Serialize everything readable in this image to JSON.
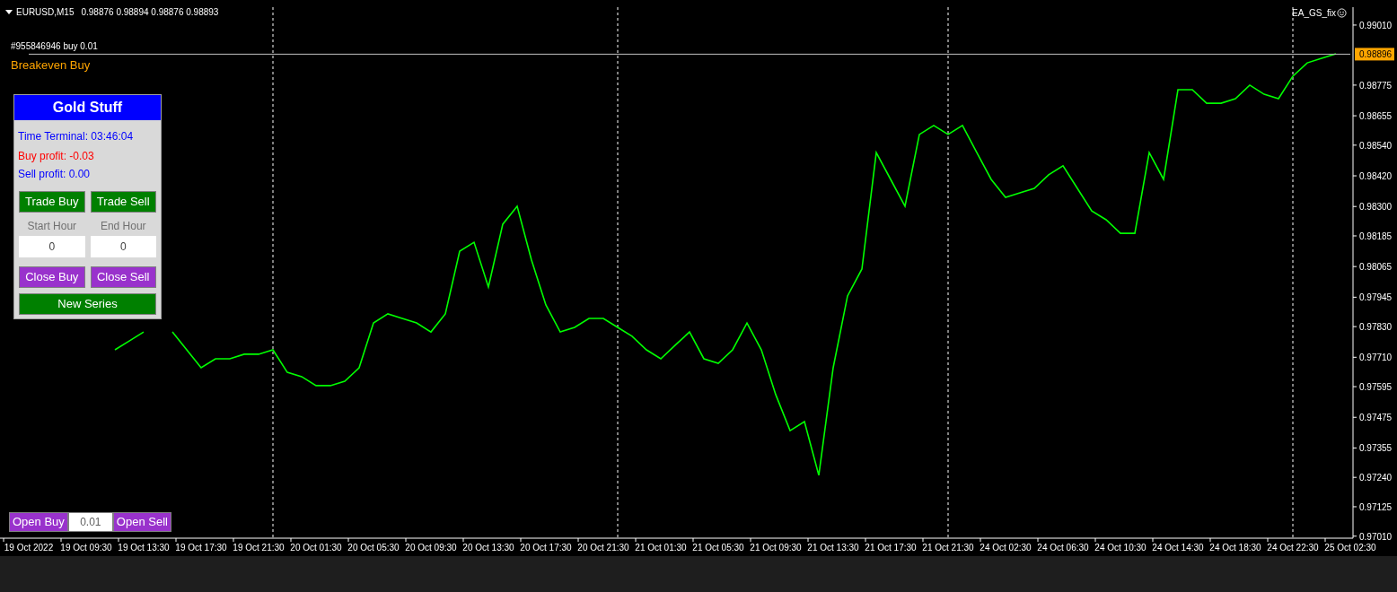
{
  "chart_header": {
    "symbol": "EURUSD,M15",
    "ohlc": "0.98876 0.98894 0.98876 0.98893"
  },
  "expert": {
    "name": "EA_GS_fix"
  },
  "order_line": {
    "label": "#955846946 buy 0.01",
    "breakeven_label": "Breakeven Buy"
  },
  "panel": {
    "title": "Gold Stuff",
    "time": "Time Terminal: 03:46:04",
    "buy_profit": "Buy profit: -0.03",
    "sell_profit": "Sell profit: 0.00",
    "trade_buttons": [
      "Trade Buy",
      "Trade Sell"
    ],
    "hour_fields": [
      {
        "label": "Start Hour",
        "value": "0"
      },
      {
        "label": "End Hour",
        "value": "0"
      }
    ],
    "close_buttons": [
      "Close Buy",
      "Close Sell"
    ],
    "series_button": "New Series"
  },
  "quick_trade": {
    "buy": "Open Buy",
    "lot": "0.01",
    "sell": "Open Sell"
  },
  "chart_data": {
    "type": "line",
    "ylim": [
      0.97002,
      0.9908
    ],
    "categories": [
      "19 Oct 2022",
      null,
      null,
      null,
      "19 Oct 09:30",
      null,
      null,
      null,
      "19 Oct 13:30",
      null,
      null,
      null,
      "19 Oct 17:30",
      null,
      null,
      null,
      "19 Oct 21:30",
      null,
      null,
      null,
      "20 Oct 01:30",
      null,
      null,
      null,
      "20 Oct 05:30",
      null,
      null,
      null,
      "20 Oct 09:30",
      null,
      null,
      null,
      "20 Oct 13:30",
      null,
      null,
      null,
      "20 Oct 17:30",
      null,
      null,
      null,
      "20 Oct 21:30",
      null,
      null,
      null,
      "21 Oct 01:30",
      null,
      null,
      null,
      "21 Oct 05:30",
      null,
      null,
      null,
      "21 Oct 09:30",
      null,
      null,
      null,
      "21 Oct 13:30",
      null,
      null,
      null,
      "21 Oct 17:30",
      null,
      null,
      null,
      "21 Oct 21:30",
      null,
      null,
      null,
      "24 Oct 02:30",
      null,
      null,
      null,
      "24 Oct 06:30",
      null,
      null,
      null,
      "24 Oct 10:30",
      null,
      null,
      null,
      "24 Oct 14:30",
      null,
      null,
      null,
      "24 Oct 18:30",
      null,
      null,
      null,
      "24 Oct 22:30",
      null,
      null,
      null,
      "25 Oct 02:30",
      null
    ],
    "yticks": [
      {
        "value": 0.9901,
        "label": "0.99010"
      },
      {
        "value": 0.98775,
        "label": "0.98775"
      },
      {
        "value": 0.98655,
        "label": "0.98655"
      },
      {
        "value": 0.9854,
        "label": "0.98540"
      },
      {
        "value": 0.9842,
        "label": "0.98420"
      },
      {
        "value": 0.983,
        "label": "0.98300"
      },
      {
        "value": 0.98185,
        "label": "0.98185"
      },
      {
        "value": 0.98065,
        "label": "0.98065"
      },
      {
        "value": 0.97945,
        "label": "0.97945"
      },
      {
        "value": 0.9783,
        "label": "0.97830"
      },
      {
        "value": 0.9771,
        "label": "0.97710"
      },
      {
        "value": 0.97595,
        "label": "0.97595"
      },
      {
        "value": 0.97475,
        "label": "0.97475"
      },
      {
        "value": 0.97355,
        "label": "0.97355"
      },
      {
        "value": 0.9724,
        "label": "0.97240"
      },
      {
        "value": 0.97125,
        "label": "0.97125"
      },
      {
        "value": 0.9701,
        "label": "0.97010"
      }
    ],
    "series": [
      {
        "color": "#00ff00",
        "values": [
          null,
          null,
          null,
          null,
          null,
          null,
          0.97739,
          0.97774,
          0.97809,
          null,
          0.97809,
          0.97739,
          0.97669,
          0.97704,
          0.97704,
          0.97722,
          0.97722,
          0.97739,
          0.97651,
          0.97634,
          0.97599,
          0.97599,
          0.97616,
          0.97669,
          0.97844,
          0.9788,
          0.97862,
          0.97844,
          0.97809,
          0.9788,
          0.98125,
          0.9816,
          0.97985,
          0.98231,
          0.98301,
          0.9809,
          0.97915,
          0.97809,
          0.97827,
          0.97862,
          0.97862,
          0.97827,
          0.97792,
          0.97739,
          0.97704,
          0.97757,
          0.97809,
          0.97704,
          0.97686,
          0.97739,
          0.97844,
          0.97739,
          0.97564,
          0.97423,
          0.97458,
          0.97248,
          0.97669,
          0.9795,
          0.98055,
          0.98511,
          0.98406,
          0.98301,
          0.98582,
          0.98617,
          0.98582,
          0.98617,
          0.98511,
          0.98406,
          0.98336,
          0.98353,
          0.98371,
          0.98424,
          0.98459,
          0.98371,
          0.98283,
          0.98248,
          0.98195,
          0.98195,
          0.98511,
          0.98406,
          0.98757,
          0.98757,
          0.98704,
          0.98704,
          0.98722,
          0.98775,
          0.98739,
          0.98722,
          0.9881,
          0.98862,
          0.9888,
          0.98897,
          null,
          null
        ]
      },
      {
        "color": "#c0c0c0",
        "values": [
          0.98896,
          0.98896,
          0.98896,
          0.98896,
          0.98896,
          0.98896,
          0.98896,
          0.98896,
          0.98896,
          0.98896,
          0.98896,
          0.98896,
          0.98896,
          0.98896,
          0.98896,
          0.98896,
          0.98896,
          0.98896,
          0.98896,
          0.98896,
          0.98896,
          0.98896,
          0.98896,
          0.98896,
          0.98896,
          0.98896,
          0.98896,
          0.98896,
          0.98896,
          0.98896,
          0.98896,
          0.98896,
          0.98896,
          0.98896,
          0.98896,
          0.98896,
          0.98896,
          0.98896,
          0.98896,
          0.98896,
          0.98896,
          0.98896,
          0.98896,
          0.98896,
          0.98896,
          0.98896,
          0.98896,
          0.98896,
          0.98896,
          0.98896,
          0.98896,
          0.98896,
          0.98896,
          0.98896,
          0.98896,
          0.98896,
          0.98896,
          0.98896,
          0.98896,
          0.98896,
          0.98896,
          0.98896,
          0.98896,
          0.98896,
          0.98896,
          0.98896,
          0.98896,
          0.98896,
          0.98896,
          0.98896,
          0.98896,
          0.98896,
          0.98896,
          0.98896,
          0.98896,
          0.98896,
          0.98896,
          0.98896,
          0.98896,
          0.98896,
          0.98896,
          0.98896,
          0.98896,
          0.98896,
          0.98896,
          0.98896,
          0.98896,
          0.98896,
          0.98896,
          0.98896,
          0.98896,
          0.98896,
          0.98896,
          null
        ]
      }
    ]
  },
  "current_price": {
    "label": "0.98896"
  }
}
